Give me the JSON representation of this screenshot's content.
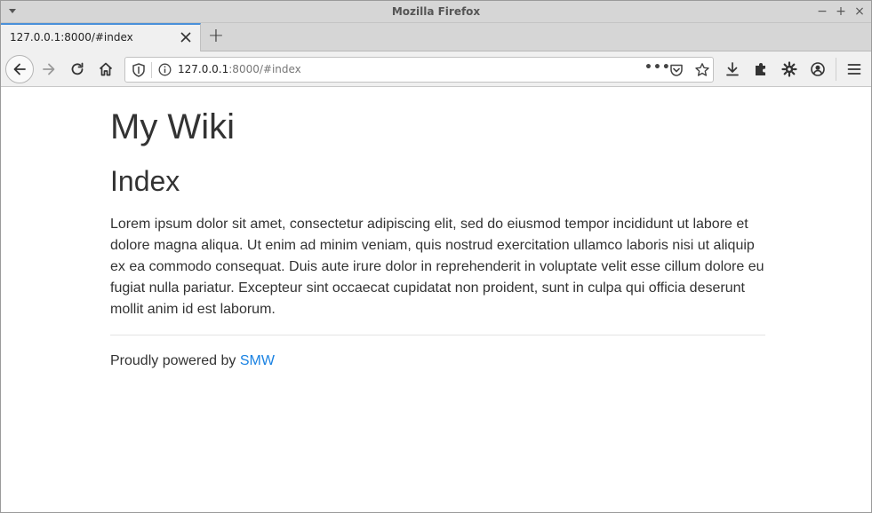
{
  "window": {
    "title": "Mozilla Firefox",
    "controls": {
      "minimize": "−",
      "maximize": "+",
      "close": "×"
    }
  },
  "tabs": [
    {
      "label": "127.0.0.1:8000/#index",
      "active": true
    }
  ],
  "new_tab_label": "+",
  "url": {
    "host": "127.0.0.1",
    "rest": ":8000/#index"
  },
  "page": {
    "site_title": "My Wiki",
    "heading": "Index",
    "body": "Lorem ipsum dolor sit amet, consectetur adipiscing elit, sed do eiusmod tempor incididunt ut labore et dolore magna aliqua. Ut enim ad minim veniam, quis nostrud exercitation ullamco laboris nisi ut aliquip ex ea commodo consequat. Duis aute irure dolor in reprehenderit in voluptate velit esse cillum dolore eu fugiat nulla pariatur. Excepteur sint occaecat cupidatat non proident, sunt in culpa qui officia deserunt mollit anim id est laborum.",
    "footer_prefix": "Proudly powered by ",
    "footer_link": "SMW"
  },
  "icons": {
    "back": "back-arrow-icon",
    "forward": "forward-arrow-icon",
    "reload": "reload-icon",
    "home": "home-icon",
    "tracking": "shield-icon",
    "site_info": "info-icon",
    "page_actions": "more-dots-icon",
    "pocket": "pocket-icon",
    "bookmark": "star-icon",
    "downloads": "download-icon",
    "extensions": "puzzle-icon",
    "settings": "gear-icon",
    "account": "account-icon",
    "app_menu": "hamburger-menu-icon"
  },
  "colors": {
    "link": "#1a82e2",
    "text": "#333333",
    "tab_accent": "#4a90d9",
    "chrome": "#d6d6d6"
  }
}
